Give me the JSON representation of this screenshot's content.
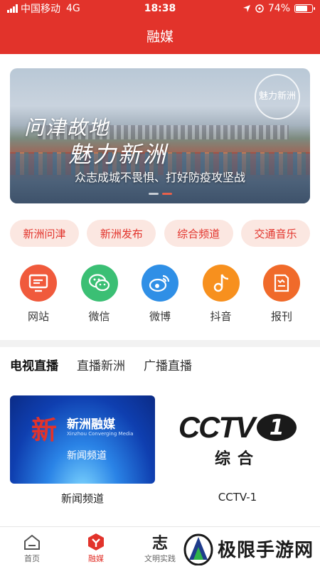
{
  "status": {
    "carrier": "中国移动",
    "network": "4G",
    "time": "18:38",
    "battery_text": "74%",
    "battery_level": 0.74
  },
  "nav": {
    "title": "融媒"
  },
  "banner": {
    "title_line1": "问津故地",
    "title_line2": "魅力新洲",
    "seal_text": "魅力新洲",
    "caption": "众志成城不畏惧、打好防疫攻坚战",
    "dots": 2,
    "active_dot": 1
  },
  "chips": [
    "新洲问津",
    "新洲发布",
    "综合频道",
    "交通音乐"
  ],
  "apps": [
    {
      "label": "网站",
      "icon": "monitor-icon",
      "color": "#f05a3c"
    },
    {
      "label": "微信",
      "icon": "wechat-icon",
      "color": "#3bbf74"
    },
    {
      "label": "微博",
      "icon": "weibo-icon",
      "color": "#2f8fe6"
    },
    {
      "label": "抖音",
      "icon": "music-note-icon",
      "color": "#f7901e"
    },
    {
      "label": "报刊",
      "icon": "newspaper-icon",
      "color": "#f06a2a"
    }
  ],
  "tabs": [
    "电视直播",
    "直播新洲",
    "广播直播"
  ],
  "tv": [
    {
      "label": "新闻频道",
      "thumb": {
        "brand": "新洲融媒",
        "brand_sub": "Xinzhou Converging Media",
        "channel": "新闻频道"
      }
    },
    {
      "label": "CCTV-1",
      "thumb": {
        "logo": "CCTV",
        "number": "1",
        "channel": "综合"
      }
    }
  ],
  "tabbar": [
    {
      "label": "首页",
      "icon": "home-icon",
      "active": false
    },
    {
      "label": "融媒",
      "icon": "hexagon-y-icon",
      "active": true
    },
    {
      "label": "文明实践",
      "icon": "calligraphy-icon",
      "active": false
    }
  ],
  "watermark": {
    "text": "极限手游网",
    "icon": "mountain-logo-icon"
  },
  "colors": {
    "brand_red": "#e2332b",
    "chip_bg": "#fbe7e1"
  }
}
